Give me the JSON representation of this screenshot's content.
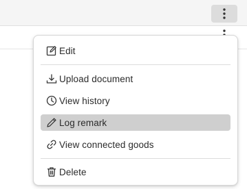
{
  "toolbar": {
    "more_button_icon": "more-vertical-icon"
  },
  "menu": {
    "items": [
      {
        "label": "Edit",
        "icon": "edit-square-icon"
      },
      {
        "label": "Upload document",
        "icon": "download-tray-icon"
      },
      {
        "label": "View history",
        "icon": "clock-history-icon"
      },
      {
        "label": "Log remark",
        "icon": "pencil-icon",
        "highlighted": true
      },
      {
        "label": "View connected goods",
        "icon": "link-icon"
      },
      {
        "label": "Delete",
        "icon": "trash-icon"
      }
    ]
  },
  "colors": {
    "highlight": "#cfcfcf",
    "toolbar_bg": "#f5f5f5",
    "text": "#2b2b2b"
  }
}
